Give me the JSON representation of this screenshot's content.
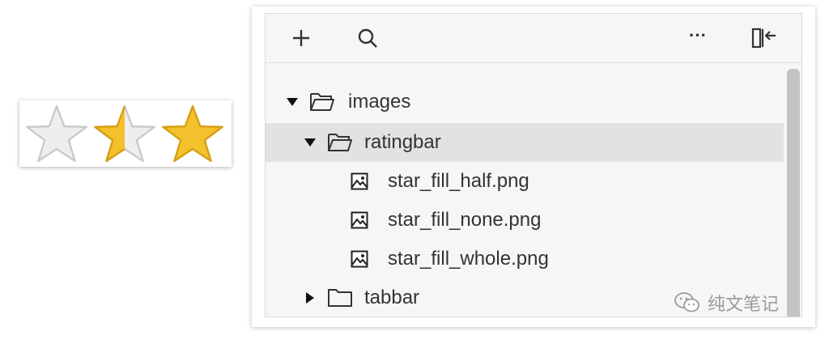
{
  "rating_preview": {
    "stars": [
      {
        "icon": "star-empty-icon",
        "fill_fraction": 0.0
      },
      {
        "icon": "star-half-icon",
        "fill_fraction": 0.5
      },
      {
        "icon": "star-full-icon",
        "fill_fraction": 1.0
      }
    ],
    "colors": {
      "fill": "#f3c12c",
      "empty": "#ededed",
      "outline": "#c9c9c9"
    }
  },
  "toolbar": {
    "add_icon": "plus-icon",
    "search_icon": "search-icon",
    "more_label": "···",
    "collapse_icon": "collapse-panel-icon"
  },
  "tree": {
    "items": [
      {
        "label": "images",
        "type": "folder",
        "expanded": true,
        "icon": "folder-open-icon"
      },
      {
        "label": "ratingbar",
        "type": "folder",
        "expanded": true,
        "selected": true,
        "icon": "folder-open-icon"
      },
      {
        "label": "star_fill_half.png",
        "type": "file",
        "icon": "image-file-icon"
      },
      {
        "label": "star_fill_none.png",
        "type": "file",
        "icon": "image-file-icon"
      },
      {
        "label": "star_fill_whole.png",
        "type": "file",
        "icon": "image-file-icon"
      },
      {
        "label": "tabbar",
        "type": "folder",
        "expanded": false,
        "icon": "folder-icon"
      }
    ]
  },
  "watermark": {
    "text": "纯文笔记",
    "icon": "wechat-icon"
  }
}
